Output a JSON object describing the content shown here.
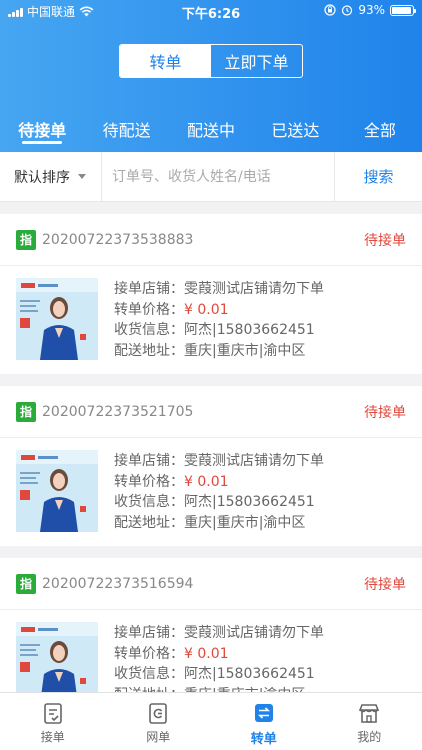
{
  "status_bar": {
    "carrier": "中国联通",
    "time": "下午6:26",
    "battery": "93%",
    "battery_level": 0.93
  },
  "segment": {
    "left": "转单",
    "right": "立即下单",
    "active": 0
  },
  "tabs": [
    {
      "label": "待接单"
    },
    {
      "label": "待配送"
    },
    {
      "label": "配送中"
    },
    {
      "label": "已送达"
    },
    {
      "label": "全部"
    }
  ],
  "filter": {
    "sort_label": "默认排序",
    "search_placeholder": "订单号、收货人姓名/电话",
    "search_button": "搜索"
  },
  "labels": {
    "tag": "指",
    "shop_key": "接单店铺：",
    "price_key": "转单价格：",
    "receiver_key": "收货信息：",
    "address_key": "配送地址："
  },
  "orders": [
    {
      "order_no": "20200722373538883",
      "status": "待接单",
      "shop": "雯葭测试店铺请勿下单",
      "price": "¥ 0.01",
      "receiver": "阿杰|15803662451",
      "address": "重庆|重庆市|渝中区"
    },
    {
      "order_no": "20200722373521705",
      "status": "待接单",
      "shop": "雯葭测试店铺请勿下单",
      "price": "¥ 0.01",
      "receiver": "阿杰|15803662451",
      "address": "重庆|重庆市|渝中区"
    },
    {
      "order_no": "20200722373516594",
      "status": "待接单",
      "shop": "雯葭测试店铺请勿下单",
      "price": "¥ 0.01",
      "receiver": "阿杰|15803662451",
      "address": "重庆|重庆市|渝中区"
    }
  ],
  "tabbar": [
    {
      "label": "接单",
      "icon": "clipboard-check-icon"
    },
    {
      "label": "网单",
      "icon": "web-order-icon"
    },
    {
      "label": "转单",
      "icon": "transfer-icon",
      "active": true
    },
    {
      "label": "我的",
      "icon": "store-icon"
    }
  ],
  "colors": {
    "brand": "#1f83ea",
    "status_red": "#e0483d",
    "tag_green": "#2bab3a"
  }
}
